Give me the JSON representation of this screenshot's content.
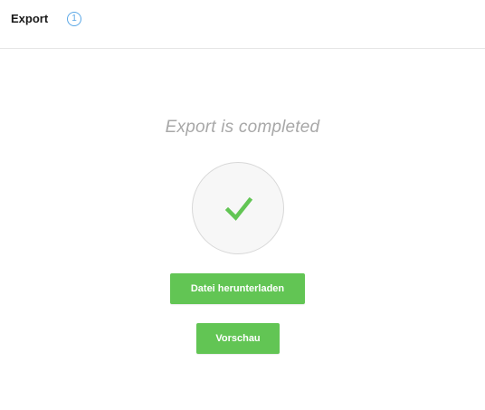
{
  "header": {
    "title": "Export",
    "badge": "1"
  },
  "main": {
    "status_text": "Export is completed",
    "status_icon": "check-icon",
    "download_button_label": "Datei herunterladen",
    "preview_button_label": "Vorschau"
  },
  "colors": {
    "accent_green": "#62c554",
    "badge_blue": "#5aa7e6",
    "status_text": "#a8a8a8"
  }
}
